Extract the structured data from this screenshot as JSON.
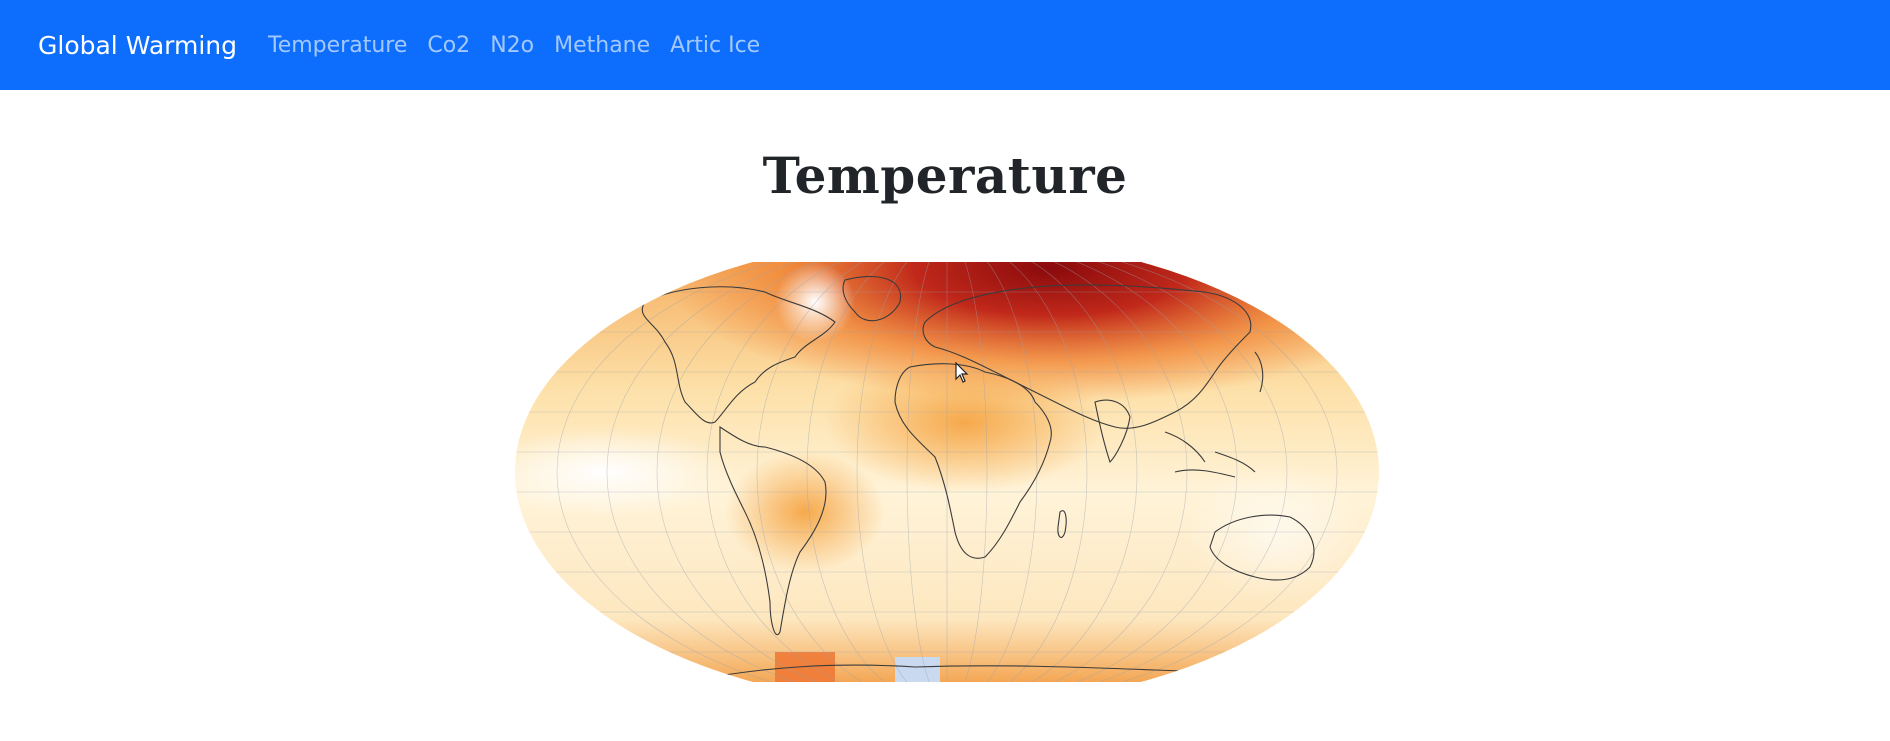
{
  "navbar": {
    "brand": "Global Warming",
    "links": [
      "Temperature",
      "Co2",
      "N2o",
      "Methane",
      "Artic Ice"
    ]
  },
  "main": {
    "title": "Temperature",
    "map": {
      "icon": "world-temperature-anomaly-map",
      "projection": "equal-earth",
      "colors": {
        "cold": "#dbe6f4",
        "neutral": "#fff8e7",
        "warm": "#fbc36a",
        "hot": "#e8541c",
        "extreme": "#8a0a0c"
      }
    }
  },
  "colors": {
    "navbar_bg": "#0d6efd",
    "brand_text": "#ffffff",
    "link_text": "#a9c8fb"
  }
}
